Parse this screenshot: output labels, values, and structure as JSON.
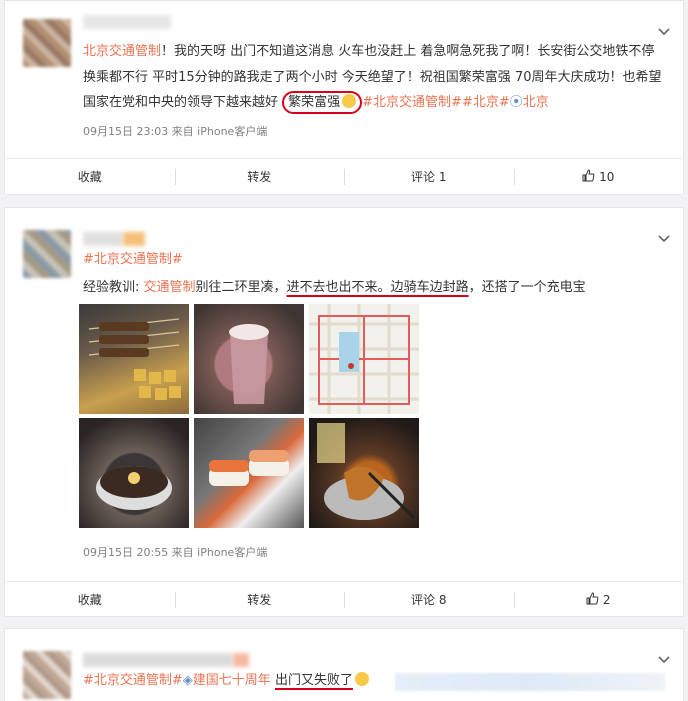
{
  "posts": [
    {
      "text": {
        "tag": "北京交通管制",
        "body1": "！我的天呀 出门不知道这消息 火车也没赶上 着急啊急死我了啊！长安街公交地铁不停 换乘都不行 平时15分钟的路我走了两个小时 今天绝望了！祝祖国繁荣富强 70周年大庆成功！也希望国家在党和中央的领导下越来越好 ",
        "circled": "繁荣富强",
        "topic1": "#北京交通管制#",
        "topic2": "#北京#",
        "location": "北京"
      },
      "meta": "09月15日 23:03  来自 iPhone客户端",
      "actions": {
        "collect": "收藏",
        "repost": "转发",
        "comment": "评论 1",
        "like": "10"
      }
    },
    {
      "topic_line": "#北京交通管制#",
      "text": {
        "prefix": "经验教训: ",
        "hl": "交通管制",
        "mid": "别往二环里凑，",
        "ul1": "进不去也出不来。",
        "ul2": "边骑车边封路",
        "tail": "，还搭了一个充电宝"
      },
      "meta": "09月15日 20:55  来自 iPhone客户端",
      "actions": {
        "collect": "收藏",
        "repost": "转发",
        "comment": "评论 8",
        "like": "2"
      }
    },
    {
      "text": {
        "topic1": "#北京交通管制#",
        "topic2": "建国七十周年",
        "ul": "出门又失败了"
      }
    }
  ]
}
